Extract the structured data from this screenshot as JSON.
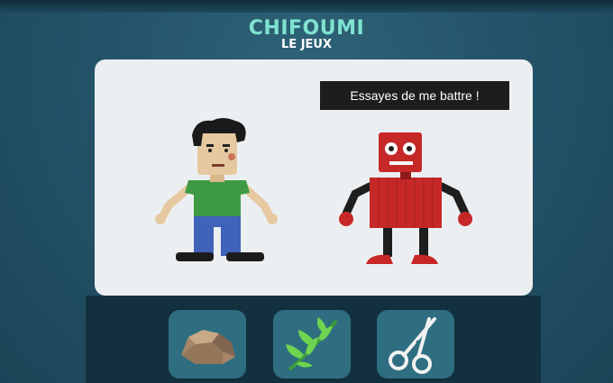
{
  "header": {
    "title": "CHIFOUMI",
    "subtitle": "LE JEUX"
  },
  "speech_bubble": {
    "text": "Essayes de me battre !"
  },
  "characters": {
    "player": "human-character",
    "opponent": "robot-character"
  },
  "choices": [
    {
      "id": "rock",
      "icon": "rock-icon"
    },
    {
      "id": "paper",
      "icon": "leaf-icon"
    },
    {
      "id": "scissors",
      "icon": "scissors-icon"
    }
  ],
  "colors": {
    "background": "#24546a",
    "title": "#7fe3d0",
    "stage": "#eceff2",
    "bubble": "#1d1d1d",
    "choice_tile": "#2e6e80",
    "robot": "#c62828",
    "shirt": "#3f9a44",
    "pants": "#3f63b8"
  }
}
